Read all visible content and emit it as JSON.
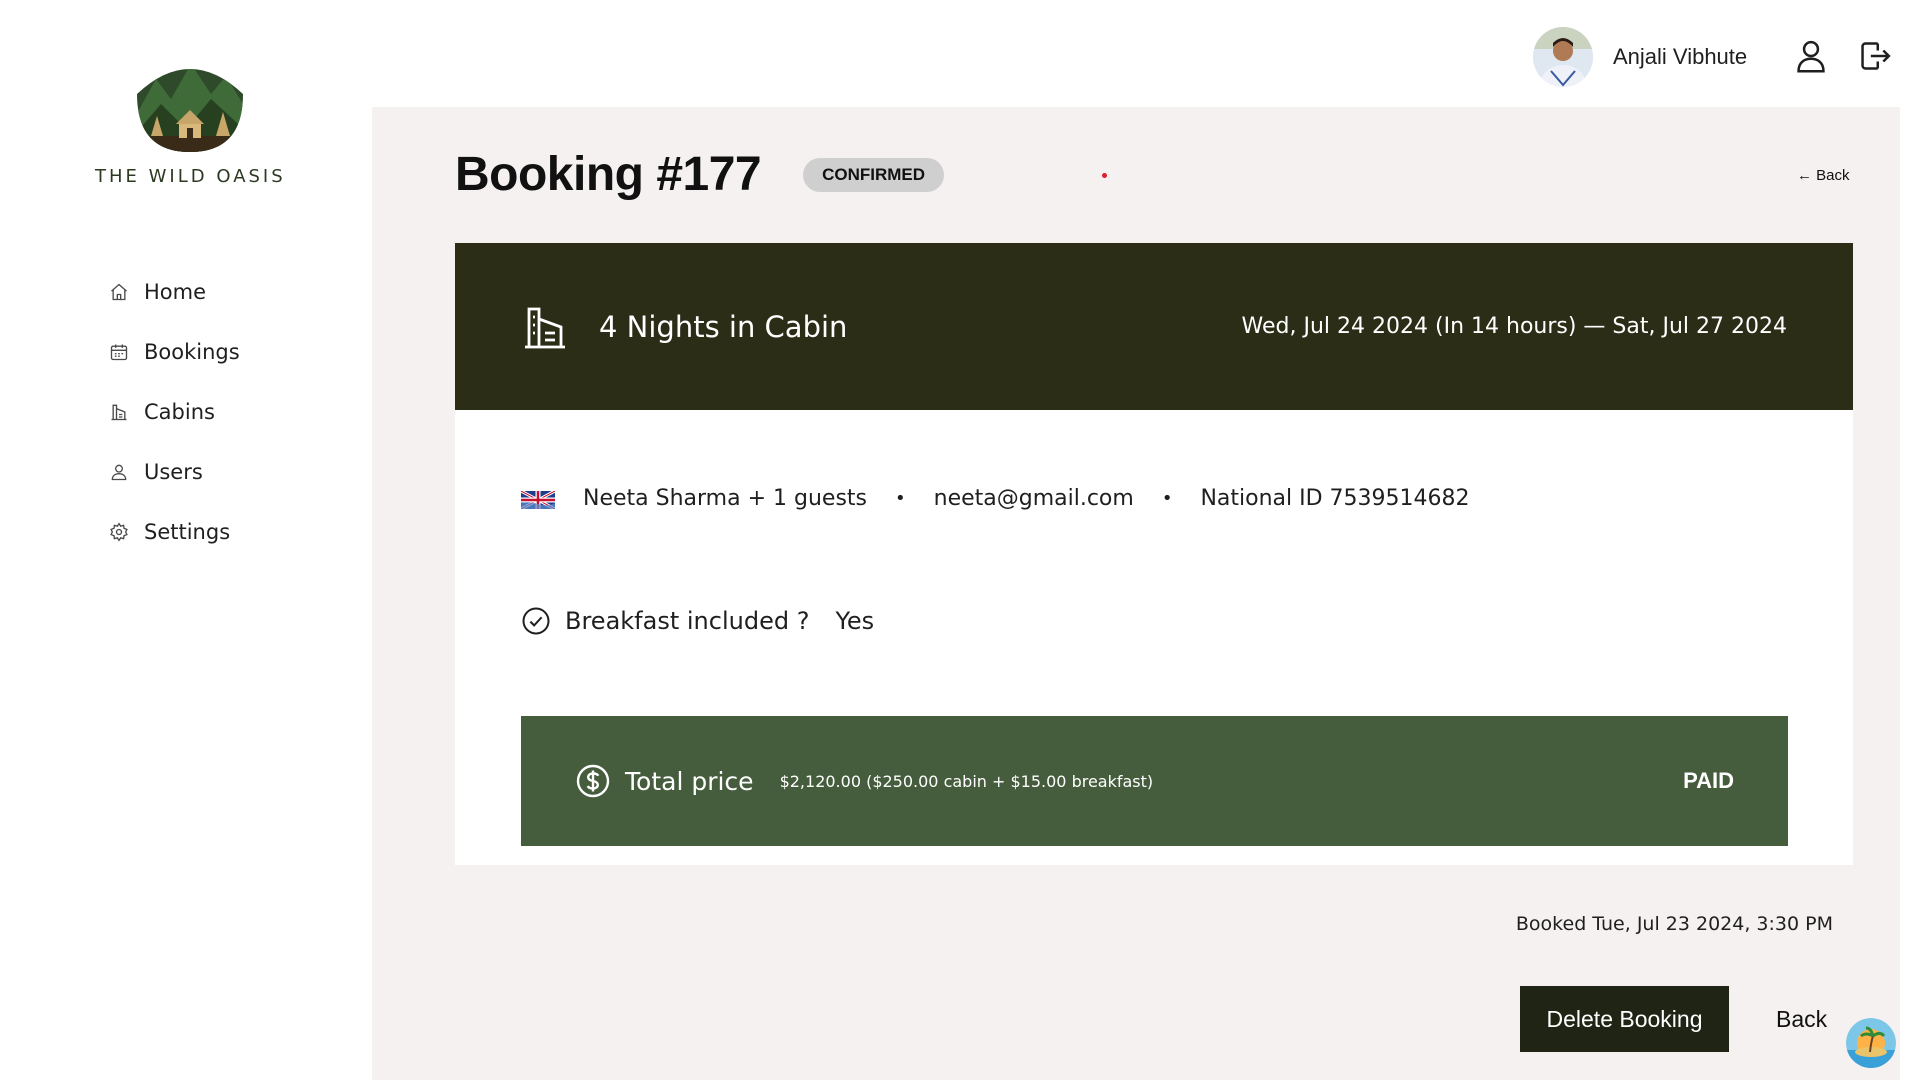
{
  "brand": {
    "name": "THE WILD OASIS",
    "logo_icon": "mountain-cabin-logo"
  },
  "sidebar": {
    "items": [
      {
        "label": "Home",
        "icon": "home-icon"
      },
      {
        "label": "Bookings",
        "icon": "calendar-icon"
      },
      {
        "label": "Cabins",
        "icon": "cabin-icon"
      },
      {
        "label": "Users",
        "icon": "user-icon"
      },
      {
        "label": "Settings",
        "icon": "gear-icon"
      }
    ]
  },
  "header": {
    "user_name": "Anjali Vibhute",
    "account_icon": "user-icon",
    "logout_icon": "logout-icon"
  },
  "booking": {
    "title": "Booking #177",
    "status": "CONFIRMED",
    "back_link": "← Back",
    "nights_label": "4 Nights in Cabin",
    "dates": "Wed, Jul 24 2024 (In 14 hours) — Sat, Jul 27 2024",
    "guest": {
      "name": "Neeta Sharma + 1 guests",
      "separator": "•",
      "email": "neeta@gmail.com",
      "national_id": "National ID 7539514682"
    },
    "breakfast_label": "Breakfast included ?",
    "breakfast_value": "Yes",
    "total_label": "Total price",
    "total_detail": "$2,120.00 ($250.00 cabin + $15.00 breakfast)",
    "payment_status": "PAID",
    "booked_on": "Booked Tue, Jul 23 2024, 3:30 PM"
  },
  "actions": {
    "delete_label": "Delete Booking",
    "back_label": "Back"
  },
  "colors": {
    "header_band": "#2b2d17",
    "price_band": "#455d3d",
    "page_bg": "#f4f1f0",
    "delete_button": "#1f2414"
  }
}
